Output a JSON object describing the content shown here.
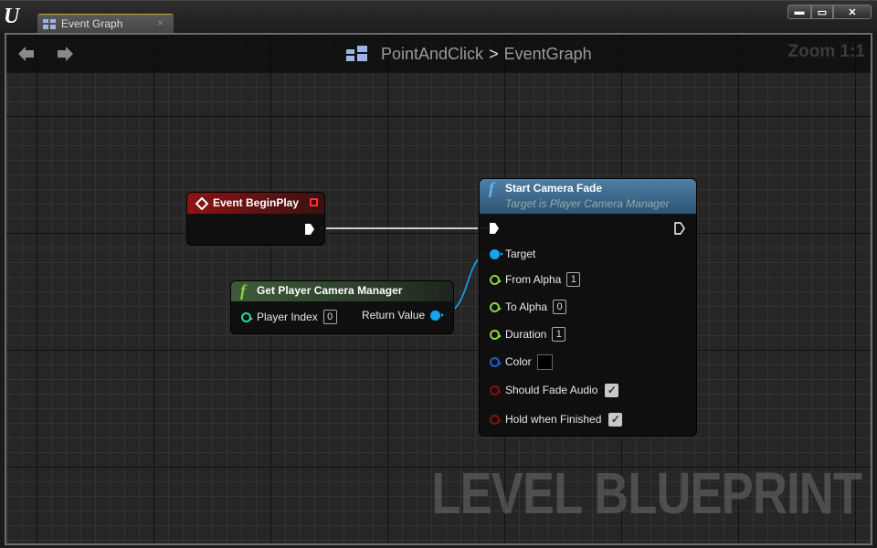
{
  "window": {
    "tab_label": "Event Graph",
    "tab_close": "×",
    "buttons": {
      "minimize": "▬",
      "maximize": "▭",
      "close": "✕"
    }
  },
  "header": {
    "breadcrumb": [
      "PointAndClick",
      "EventGraph"
    ],
    "separator": ">",
    "zoom": "Zoom 1:1"
  },
  "watermark": "LEVEL BLUEPRINT",
  "colors": {
    "event_header": "#8b1414",
    "pure_func_header": "#3f5a3a",
    "func_header": "#3a6a8c",
    "object_pin": "#12a4f3",
    "float_pin": "#8fd33a",
    "int_pin": "#2fd3a4",
    "struct_pin": "#1a5fd0",
    "bool_pin": "#8a0e0e",
    "exec_wire": "#cfcfcf"
  },
  "nodes": {
    "begin_play": {
      "title": "Event BeginPlay"
    },
    "get_pcm": {
      "title": "Get Player Camera Manager",
      "input": {
        "label": "Player Index",
        "value": "0"
      },
      "output": {
        "label": "Return Value"
      }
    },
    "start_fade": {
      "title": "Start Camera Fade",
      "subtitle": "Target is Player Camera Manager",
      "pins": [
        {
          "label": "Target",
          "type": "object"
        },
        {
          "label": "From Alpha",
          "type": "float",
          "value": "1"
        },
        {
          "label": "To Alpha",
          "type": "float",
          "value": "0"
        },
        {
          "label": "Duration",
          "type": "float",
          "value": "1"
        },
        {
          "label": "Color",
          "type": "struct",
          "value_color": "#000000"
        },
        {
          "label": "Should Fade Audio",
          "type": "bool",
          "checked": true
        },
        {
          "label": "Hold when Finished",
          "type": "bool",
          "checked": true
        }
      ]
    }
  }
}
